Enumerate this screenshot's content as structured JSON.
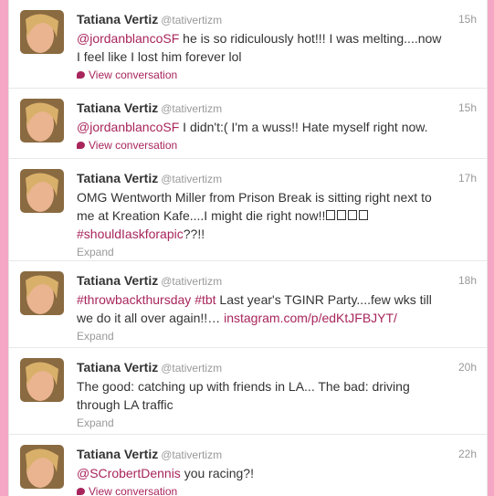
{
  "colors": {
    "page_bg": "#f4a6c4",
    "link": "#a8255c",
    "muted": "#999999"
  },
  "tweets": [
    {
      "name": "Tatiana Vertiz",
      "handle": "@tativertizm",
      "time": "15h",
      "mention": "@jordanblancoSF",
      "text": " he is so ridiculously hot!!! I was melting....now I feel like I lost him forever lol",
      "action": "View conversation"
    },
    {
      "name": "Tatiana Vertiz",
      "handle": "@tativertizm",
      "time": "15h",
      "mention": "@jordanblancoSF",
      "text": " I didn't:( I'm a wuss!! Hate myself right now.",
      "action": "View conversation"
    },
    {
      "name": "Tatiana Vertiz",
      "handle": "@tativertizm",
      "time": "17h",
      "text": "OMG Wentworth Miller from Prison Break is sitting right next to me at Kreation Kafe....I might die right now!!",
      "hashtag": "#shouldIaskforapic",
      "text_end": "??!!",
      "action": "Expand"
    },
    {
      "name": "Tatiana Vertiz",
      "handle": "@tativertizm",
      "time": "18h",
      "hashtag": "#throwbackthursday",
      "hashtag2": "#tbt",
      "text": " Last year's TGINR Party....few wks till we do it all over again!!… ",
      "link": "instagram.com/p/edKtJFBJYT/",
      "action": "Expand"
    },
    {
      "name": "Tatiana Vertiz",
      "handle": "@tativertizm",
      "time": "20h",
      "text": "The good: catching up with friends in LA... The bad: driving through LA traffic",
      "action": "Expand"
    },
    {
      "name": "Tatiana Vertiz",
      "handle": "@tativertizm",
      "time": "22h",
      "mention": "@SCrobertDennis",
      "text": " you racing?!",
      "action": "View conversation"
    }
  ]
}
